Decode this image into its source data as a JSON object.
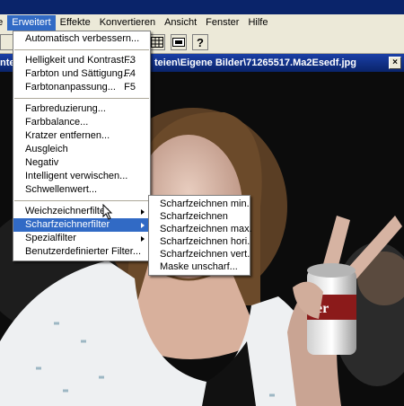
{
  "menubar": {
    "items": [
      {
        "label": "ne",
        "active": false
      },
      {
        "label": "Erweitert",
        "active": true
      },
      {
        "label": "Effekte",
        "active": false
      },
      {
        "label": "Konvertieren",
        "active": false
      },
      {
        "label": "Ansicht",
        "active": false
      },
      {
        "label": "Fenster",
        "active": false
      },
      {
        "label": "Hilfe",
        "active": false
      }
    ]
  },
  "document": {
    "title_left": "nte",
    "title_right": "teien\\Eigene Bilder\\71265517.Ma2Esedf.jpg",
    "close_label": "×"
  },
  "erweitert_menu": {
    "items": [
      {
        "label": "Automatisch verbessern...",
        "shortcut": ""
      },
      {
        "label": "Helligkeit und Kontrast...",
        "shortcut": "F3"
      },
      {
        "label": "Farbton und Sättigung...",
        "shortcut": "F4"
      },
      {
        "label": "Farbtonanpassung...",
        "shortcut": "F5"
      },
      {
        "label": "Farbreduzierung...",
        "shortcut": ""
      },
      {
        "label": "Farbbalance...",
        "shortcut": ""
      },
      {
        "label": "Kratzer entfernen...",
        "shortcut": ""
      },
      {
        "label": "Ausgleich",
        "shortcut": ""
      },
      {
        "label": "Negativ",
        "shortcut": ""
      },
      {
        "label": "Intelligent verwischen...",
        "shortcut": ""
      },
      {
        "label": "Schwellenwert...",
        "shortcut": ""
      },
      {
        "label": "Weichzeichnerfilter",
        "shortcut": ""
      },
      {
        "label": "Scharfzeichnerfilter",
        "shortcut": ""
      },
      {
        "label": "Spezialfilter",
        "shortcut": ""
      },
      {
        "label": "Benutzerdefinierter Filter...",
        "shortcut": ""
      }
    ]
  },
  "scharfzeichner_submenu": {
    "items": [
      {
        "label": "Scharfzeichnen min."
      },
      {
        "label": "Scharfzeichnen"
      },
      {
        "label": "Scharfzeichnen max."
      },
      {
        "label": "Scharfzeichnen hori."
      },
      {
        "label": "Scharfzeichnen vert."
      },
      {
        "label": "Maske unscharf..."
      }
    ]
  },
  "photo": {
    "can_label": "er"
  },
  "colors": {
    "menu_highlight": "#316ac5",
    "title_bar": "#0a246a",
    "chrome": "#ece9d8"
  }
}
